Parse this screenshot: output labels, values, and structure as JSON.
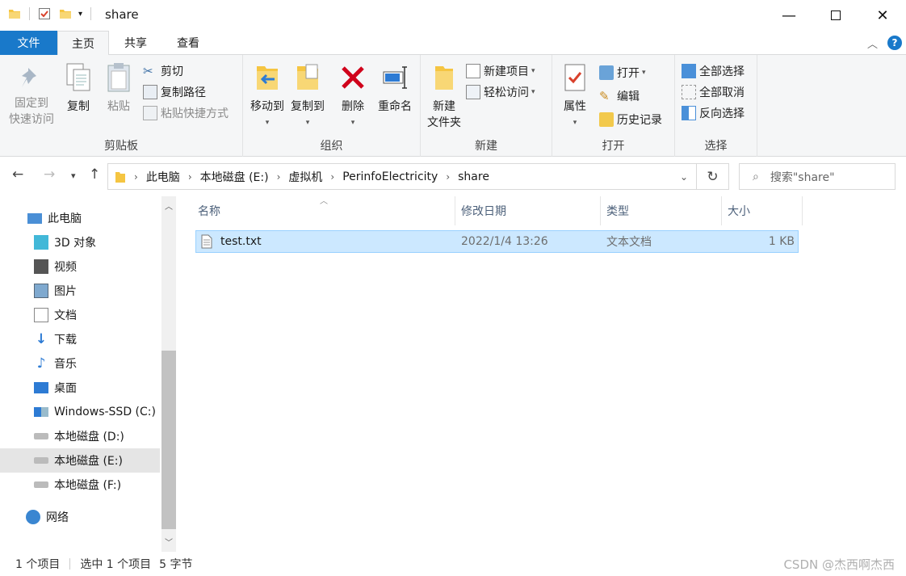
{
  "window": {
    "title": "share"
  },
  "tabs": [
    "文件",
    "主页",
    "共享",
    "查看"
  ],
  "ribbon": {
    "clipboard": {
      "label": "剪贴板",
      "pin": "固定到\n快速访问",
      "copy": "复制",
      "paste": "粘贴",
      "cut": "剪切",
      "copy_path": "复制路径",
      "paste_shortcut": "粘贴快捷方式"
    },
    "organize": {
      "label": "组织",
      "move_to": "移动到",
      "copy_to": "复制到",
      "delete": "删除",
      "rename": "重命名"
    },
    "new": {
      "label": "新建",
      "new_folder_1": "新建",
      "new_folder_2": "文件夹",
      "new_item": "新建项目",
      "easy_access": "轻松访问"
    },
    "open": {
      "label": "打开",
      "properties": "属性",
      "open": "打开",
      "edit": "编辑",
      "history": "历史记录"
    },
    "select": {
      "label": "选择",
      "select_all": "全部选择",
      "select_none": "全部取消",
      "invert": "反向选择"
    }
  },
  "address": {
    "crumbs": [
      "此电脑",
      "本地磁盘 (E:)",
      "虚拟机",
      "PerinfoElectricity",
      "share"
    ],
    "search_placeholder": "搜索\"share\""
  },
  "nav": {
    "items": [
      {
        "label": "此电脑",
        "icon": "computer-icon"
      },
      {
        "label": "3D 对象",
        "icon": "cube-icon"
      },
      {
        "label": "视频",
        "icon": "video-icon"
      },
      {
        "label": "图片",
        "icon": "picture-icon"
      },
      {
        "label": "文档",
        "icon": "document-icon"
      },
      {
        "label": "下载",
        "icon": "download-icon"
      },
      {
        "label": "音乐",
        "icon": "music-icon"
      },
      {
        "label": "桌面",
        "icon": "desktop-icon"
      },
      {
        "label": "Windows-SSD (C:)",
        "icon": "windows-drive-icon"
      },
      {
        "label": "本地磁盘 (D:)",
        "icon": "drive-icon"
      },
      {
        "label": "本地磁盘 (E:)",
        "icon": "drive-icon",
        "selected": true
      },
      {
        "label": "本地磁盘 (F:)",
        "icon": "drive-icon"
      },
      {
        "label": "网络",
        "icon": "network-icon"
      }
    ]
  },
  "list": {
    "columns": [
      "名称",
      "修改日期",
      "类型",
      "大小"
    ],
    "rows": [
      {
        "name": "test.txt",
        "modified": "2022/1/4 13:26",
        "type": "文本文档",
        "size": "1 KB"
      }
    ]
  },
  "status": {
    "count": "1 个项目",
    "selected": "选中 1 个项目",
    "size": "5 字节"
  },
  "watermark": "CSDN @杰西啊杰西"
}
